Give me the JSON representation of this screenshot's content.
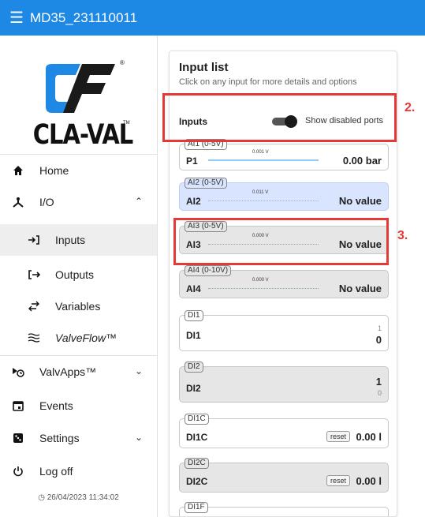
{
  "app": {
    "title": "MD35_231110011"
  },
  "brand": {
    "wordmark": "CLA-VAL",
    "registered": "®",
    "trademark": "TM"
  },
  "sidebar": {
    "items": [
      {
        "label": "Home",
        "icon": "home-icon"
      },
      {
        "label": "I/O",
        "icon": "io-icon",
        "expanded": true
      },
      {
        "label": "Inputs",
        "icon": "input-arrow-icon",
        "active": true
      },
      {
        "label": "Outputs",
        "icon": "output-arrow-icon"
      },
      {
        "label": "Variables",
        "icon": "swap-arrows-icon"
      },
      {
        "label": "ValveFlow™",
        "icon": "waves-icon"
      },
      {
        "label": "ValvApps™",
        "icon": "valve-apps-icon"
      },
      {
        "label": "Events",
        "icon": "calendar-icon"
      },
      {
        "label": "Settings",
        "icon": "settings-dice-icon"
      },
      {
        "label": "Log off",
        "icon": "power-icon"
      }
    ],
    "datetime": "26/04/2023 11:34:02"
  },
  "main": {
    "title": "Input list",
    "subtitle": "Click on any input for more details and options",
    "inputs_label": "Inputs",
    "toggle_label": "Show disabled ports",
    "toggle_on": true,
    "ports": [
      {
        "tag": "AI1 (0-5V)",
        "name": "P1",
        "mini": "0.001 V",
        "value": "0.00 bar"
      },
      {
        "tag": "AI2 (0-5V)",
        "name": "AI2",
        "mini": "0.011 V",
        "value": "No value"
      },
      {
        "tag": "AI3 (0-5V)",
        "name": "AI3",
        "mini": "0.000 V",
        "value": "No value"
      },
      {
        "tag": "AI4 (0-10V)",
        "name": "AI4",
        "mini": "0.000 V",
        "value": "No value"
      },
      {
        "tag": "DI1",
        "name": "DI1",
        "small": "1",
        "value": "0"
      },
      {
        "tag": "DI2",
        "name": "DI2",
        "value": "1",
        "small": "0"
      },
      {
        "tag": "DI1C",
        "name": "DI1C",
        "reset": "reset",
        "value": "0.00 l"
      },
      {
        "tag": "DI2C",
        "name": "DI2C",
        "reset": "reset",
        "value": "0.00 l"
      },
      {
        "tag": "DI1F"
      }
    ]
  },
  "annotations": {
    "a2": "2.",
    "a3": "3."
  },
  "colors": {
    "topbar": "#1e88e5",
    "highlight": "#e53935",
    "blue_card": "#d9e5ff",
    "grey_card": "#e6e6e6"
  }
}
